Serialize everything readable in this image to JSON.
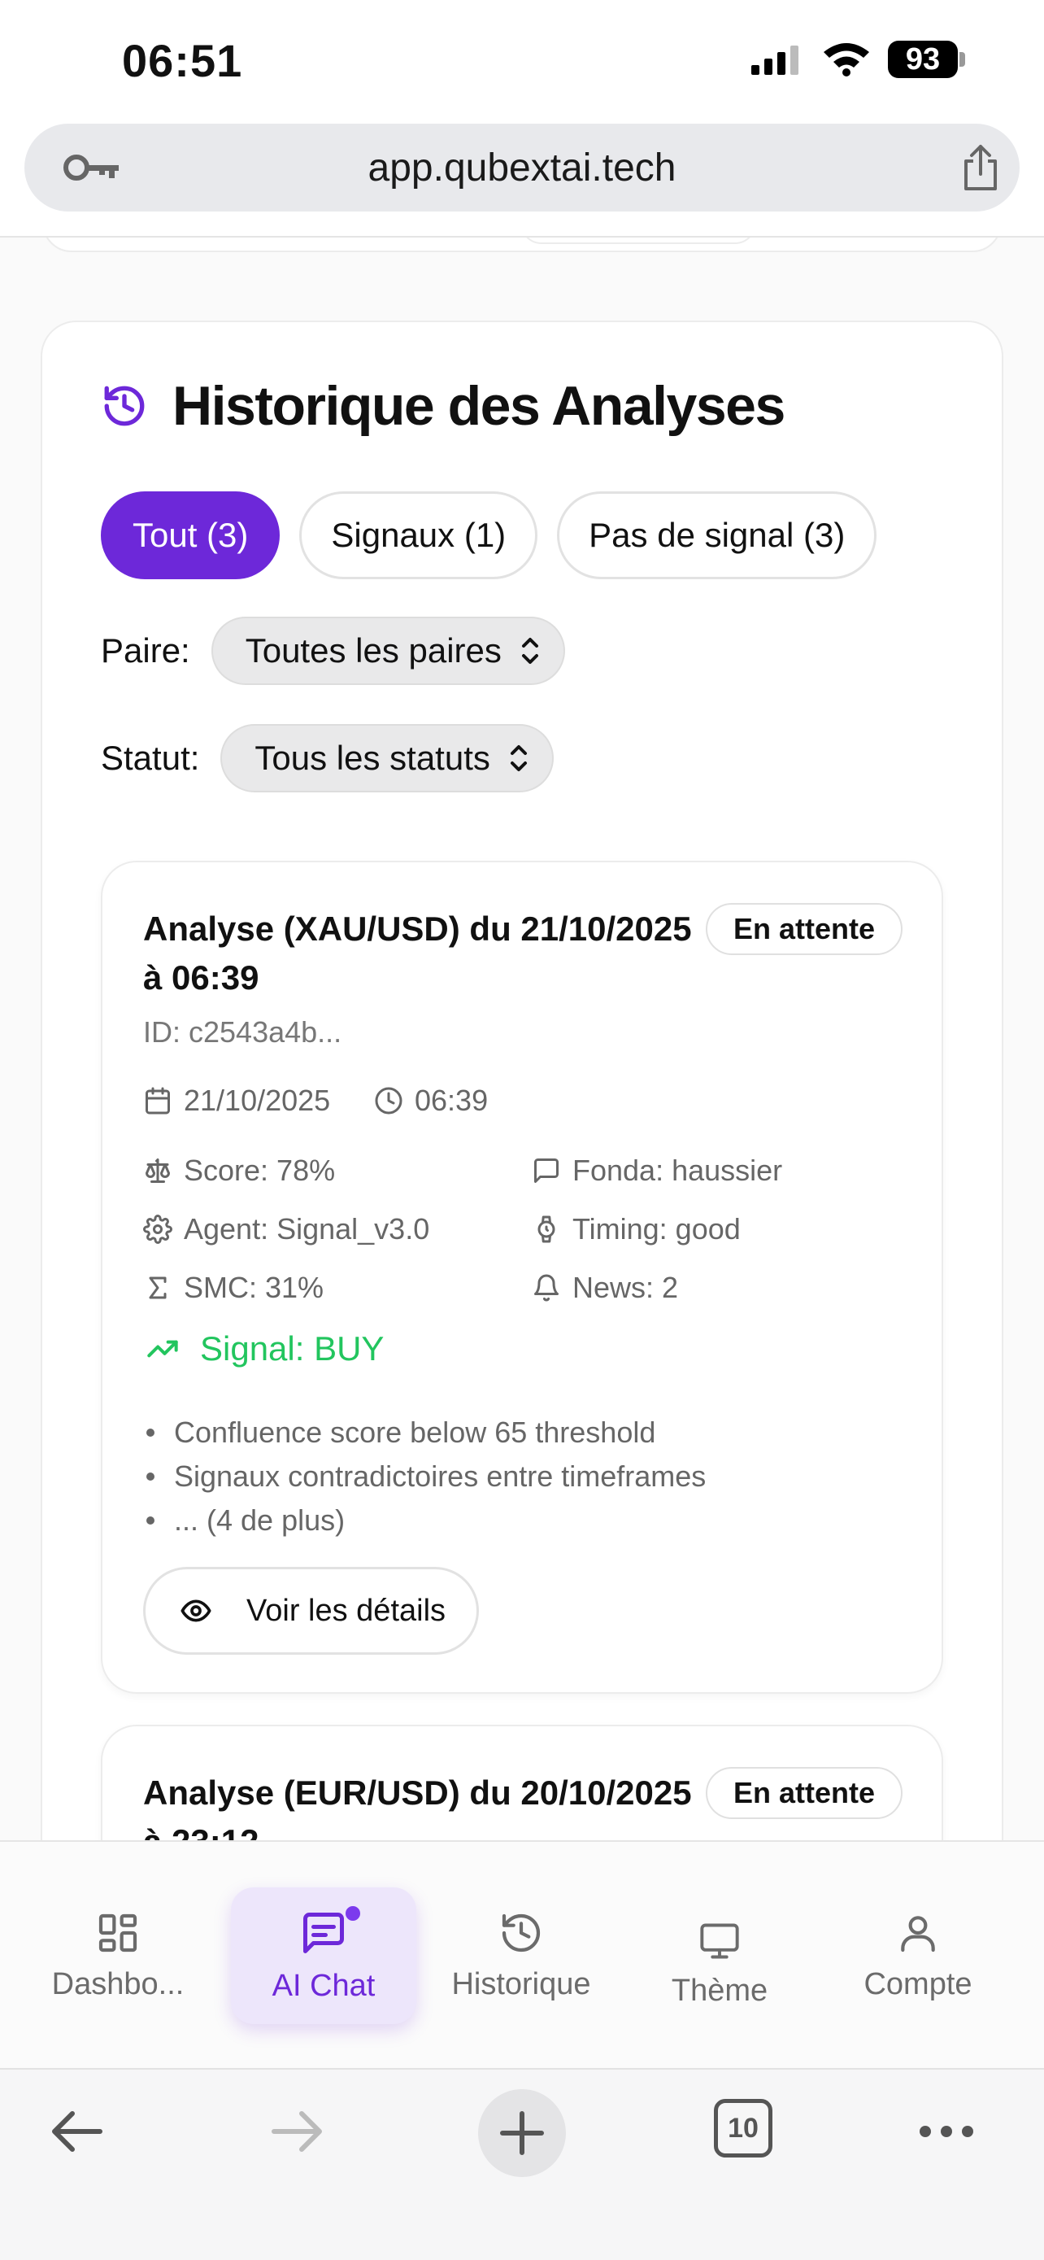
{
  "status_bar": {
    "time": "06:51",
    "battery": "93"
  },
  "browser": {
    "url": "app.qubextai.tech",
    "tabs_count": "10"
  },
  "history": {
    "title": "Historique des Analyses",
    "filters": [
      {
        "label": "Tout (3)",
        "active": true
      },
      {
        "label": "Signaux (1)",
        "active": false
      },
      {
        "label": "Pas de signal (3)",
        "active": false
      }
    ],
    "pair_label": "Paire:",
    "pair_value": "Toutes les paires",
    "status_label": "Statut:",
    "status_value": "Tous les statuts"
  },
  "analyses": [
    {
      "title": "Analyse (XAU/USD) du 21/10/2025 à 06:39",
      "status": "En attente",
      "id": "ID: c2543a4b...",
      "date": "21/10/2025",
      "time": "06:39",
      "score": "Score: 78%",
      "fonda": "Fonda: haussier",
      "agent": "Agent: Signal_v3.0",
      "timing": "Timing: good",
      "smc": "SMC: 31%",
      "news": "News: 2",
      "signal": "Signal: BUY",
      "reasons": [
        "Confluence score below 65 threshold",
        "Signaux contradictoires entre timeframes",
        "... (4 de plus)"
      ],
      "details_label": "Voir les détails"
    },
    {
      "title": "Analyse (EUR/USD) du 20/10/2025 à 23:12",
      "status": "En attente"
    }
  ],
  "nav": {
    "tabs": [
      {
        "label": "Dashbo...",
        "icon": "dashboard-icon"
      },
      {
        "label": "AI Chat",
        "icon": "chat-icon",
        "active": true
      },
      {
        "label": "Historique",
        "icon": "history-icon"
      },
      {
        "label": "Thème",
        "icon": "monitor-icon"
      },
      {
        "label": "Compte",
        "icon": "user-icon"
      }
    ]
  },
  "colors": {
    "accent": "#6d28d9",
    "signal_buy": "#22c55e"
  }
}
